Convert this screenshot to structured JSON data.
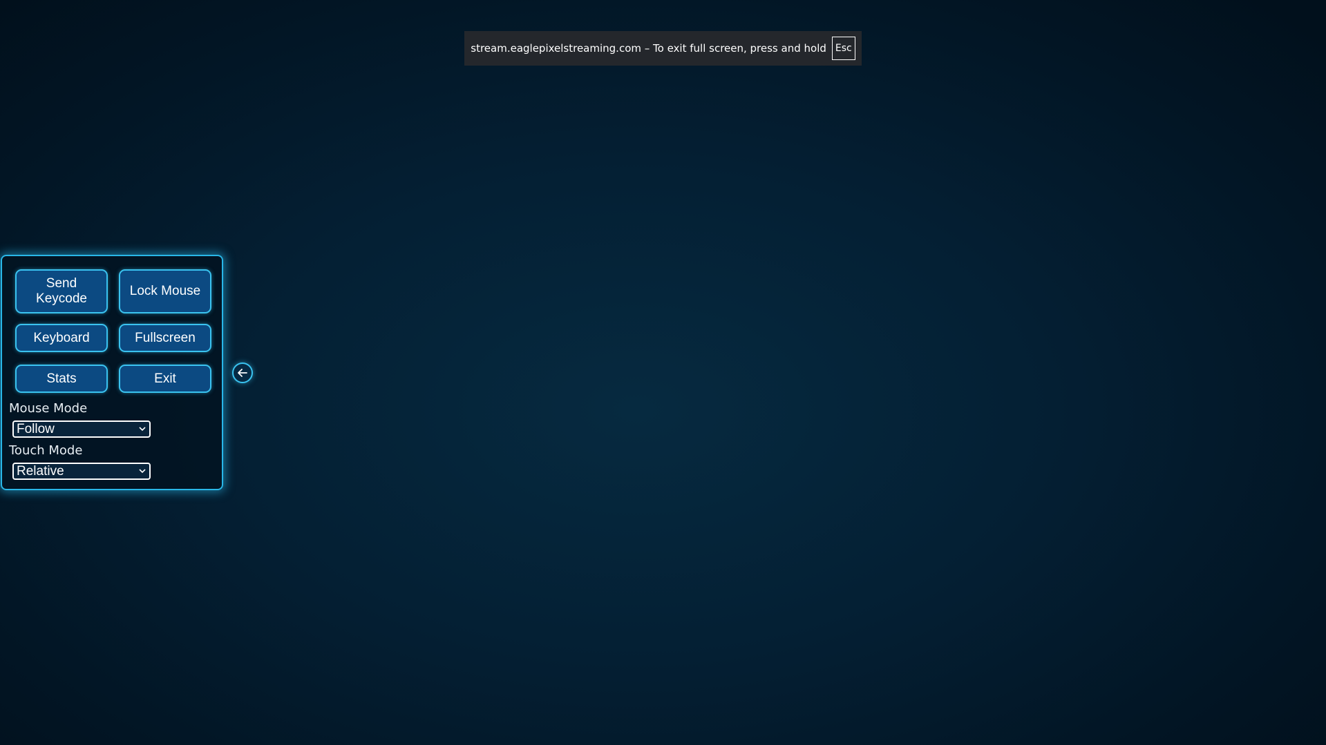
{
  "fullscreen_notice": {
    "text": "stream.eaglepixelstreaming.com – To exit full screen, press and hold",
    "key": "Esc"
  },
  "controls": {
    "buttons": {
      "send_keycode": "Send\nKeycode",
      "lock_mouse": "Lock Mouse",
      "keyboard": "Keyboard",
      "fullscreen": "Fullscreen",
      "stats": "Stats",
      "exit": "Exit"
    },
    "mouse_mode": {
      "label": "Mouse Mode",
      "selected": "Follow"
    },
    "touch_mode": {
      "label": "Touch Mode",
      "selected": "Relative"
    }
  },
  "icons": {
    "collapse": "arrow-left-circle-icon",
    "dropdown": "chevron-down-icon"
  },
  "colors": {
    "accent": "#29b7e8",
    "button_fill": "#0c4a82",
    "notice_bg": "#24272c",
    "background": "#041f33"
  }
}
